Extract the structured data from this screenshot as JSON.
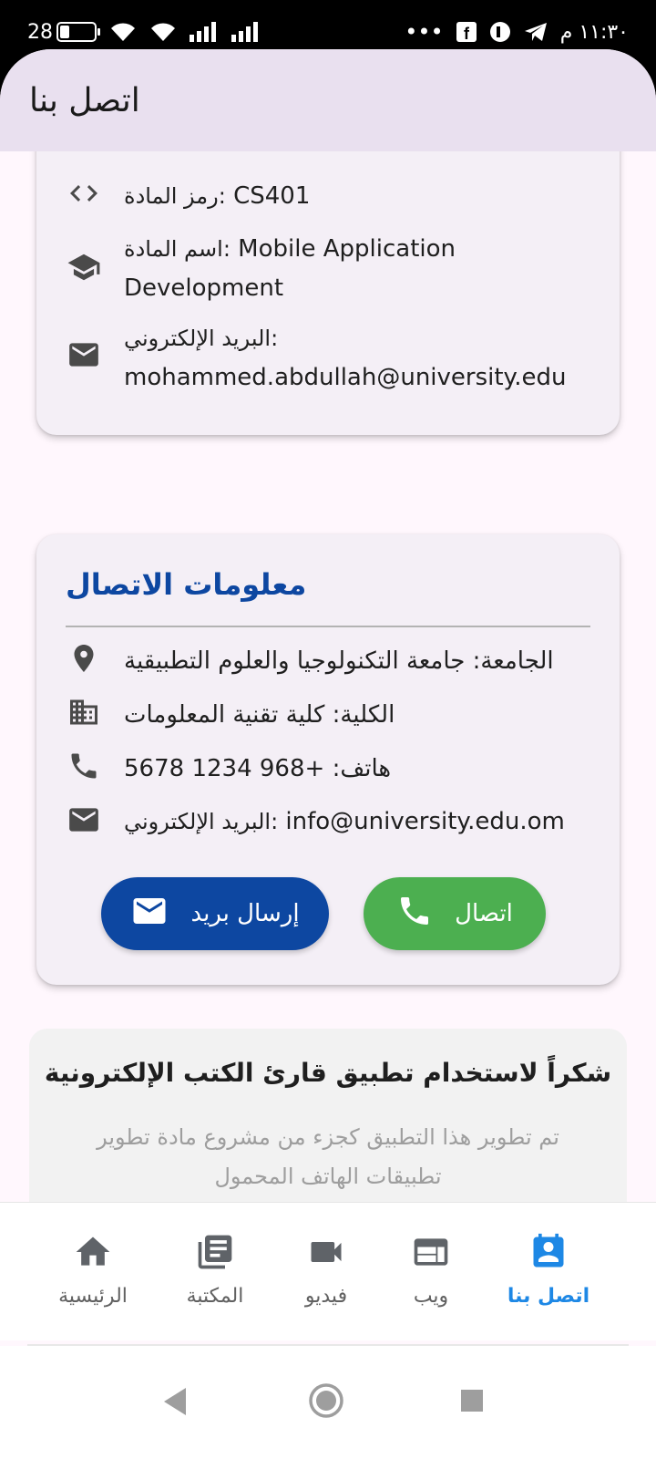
{
  "status_bar": {
    "battery": "28",
    "time": "١١:٣٠ م",
    "dots": "•••"
  },
  "app_bar": {
    "title": "اتصل بنا"
  },
  "course_card": {
    "code_label": "رمز المادة:",
    "code_value": "CS401",
    "name_label": "اسم المادة:",
    "name_value": "Mobile Application Development",
    "email_label": "البريد الإلكتروني:",
    "email_value": "mohammed.abdullah@university.edu"
  },
  "contact_card": {
    "heading": "معلومات الاتصال",
    "university": "الجامعة: جامعة التكنولوجيا والعلوم التطبيقية",
    "college": "الكلية: كلية تقنية المعلومات",
    "phone": "هاتف: +968 1234 5678",
    "email_label": "البريد الإلكتروني:",
    "email_value": "info@university.edu.om",
    "send_mail_button": "إرسال بريد",
    "call_button": "اتصال"
  },
  "thanks": {
    "title": "شكراً لاستخدام تطبيق قارئ الكتب الإلكترونية",
    "subtitle": "تم تطوير هذا التطبيق كجزء من مشروع مادة تطوير تطبيقات الهاتف المحمول"
  },
  "bottom_nav": {
    "items": [
      {
        "label": "الرئيسية",
        "icon": "home-icon"
      },
      {
        "label": "المكتبة",
        "icon": "library-icon"
      },
      {
        "label": "فيديو",
        "icon": "video-icon"
      },
      {
        "label": "ويب",
        "icon": "web-icon"
      },
      {
        "label": "اتصل بنا",
        "icon": "contact-icon",
        "active": true
      }
    ]
  },
  "colors": {
    "primary_blue": "#0d47a1",
    "green": "#4caf50",
    "active_nav": "#1e88e5",
    "app_bar_bg": "#e9e0ef"
  }
}
